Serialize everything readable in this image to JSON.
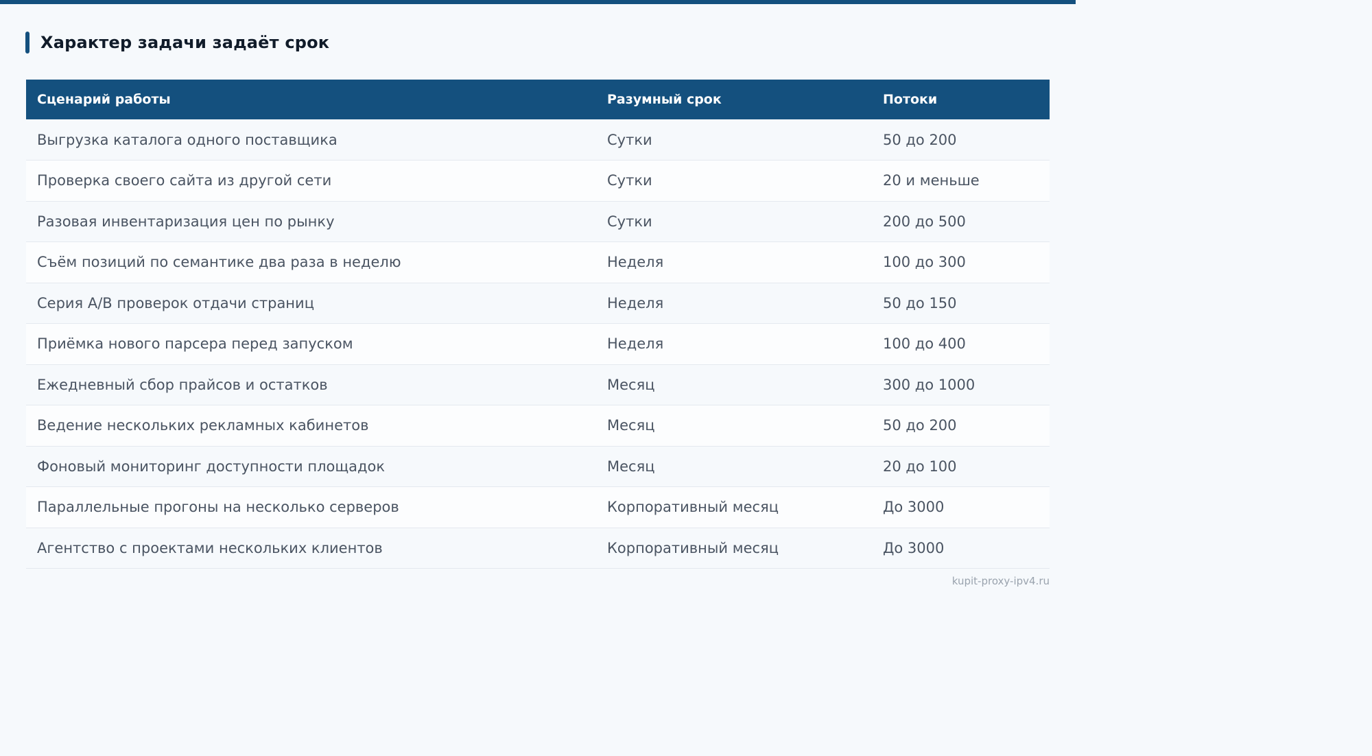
{
  "title": "Характер задачи задаёт срок",
  "table": {
    "headers": [
      "Сценарий работы",
      "Разумный срок",
      "Потоки"
    ],
    "rows": [
      [
        "Выгрузка каталога одного поставщика",
        "Сутки",
        "50 до 200"
      ],
      [
        "Проверка своего сайта из другой сети",
        "Сутки",
        "20 и меньше"
      ],
      [
        "Разовая инвентаризация цен по рынку",
        "Сутки",
        "200 до 500"
      ],
      [
        "Съём позиций по семантике два раза в неделю",
        "Неделя",
        "100 до 300"
      ],
      [
        "Серия A/B проверок отдачи страниц",
        "Неделя",
        "50 до 150"
      ],
      [
        "Приёмка нового парсера перед запуском",
        "Неделя",
        "100 до 400"
      ],
      [
        "Ежедневный сбор прайсов и остатков",
        "Месяц",
        "300 до 1000"
      ],
      [
        "Ведение нескольких рекламных кабинетов",
        "Месяц",
        "50 до 200"
      ],
      [
        "Фоновый мониторинг доступности площадок",
        "Месяц",
        "20 до 100"
      ],
      [
        "Параллельные прогоны на несколько серверов",
        "Корпоративный месяц",
        "До 3000"
      ],
      [
        "Агентство с проектами нескольких клиентов",
        "Корпоративный месяц",
        "До 3000"
      ]
    ]
  },
  "watermark": "kupit-proxy-ipv4.ru",
  "colors": {
    "accent": "#14507e",
    "background": "#f6f9fc",
    "text": "#4a5462"
  }
}
